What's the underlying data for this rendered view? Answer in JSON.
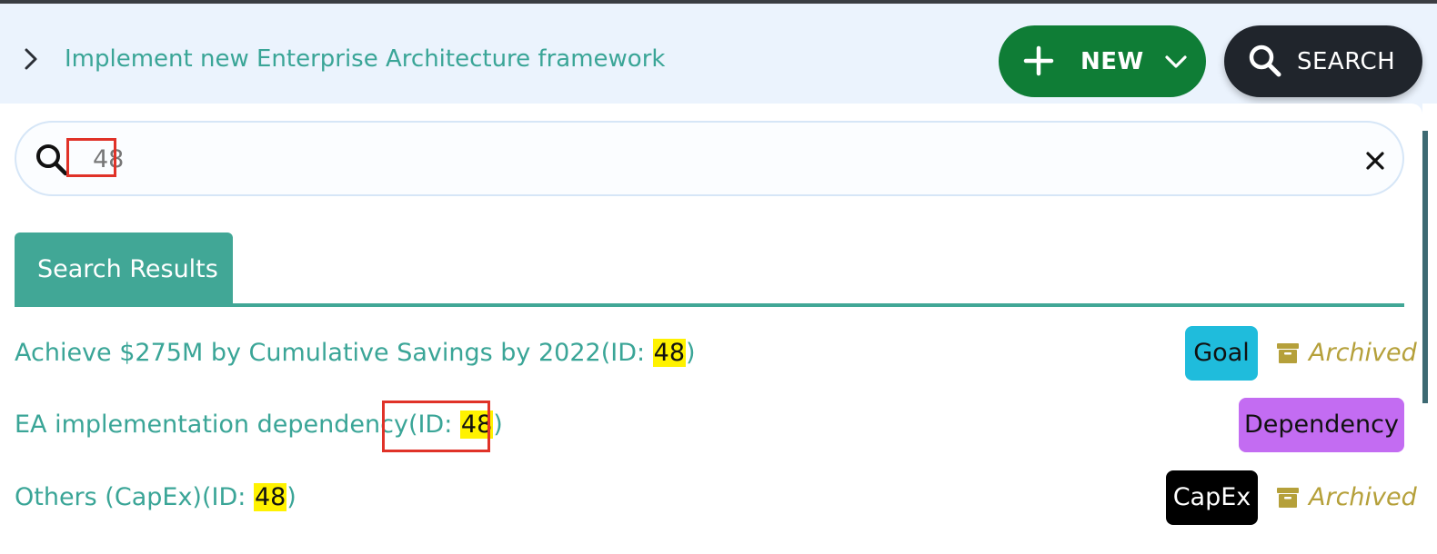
{
  "breadcrumb": {
    "current": "Implement new Enterprise Architecture framework"
  },
  "header": {
    "new_label": "NEW",
    "search_label": "SEARCH"
  },
  "search": {
    "value": "48"
  },
  "tabs": [
    {
      "label": "Search Results"
    }
  ],
  "results": [
    {
      "title": "Achieve $275M by Cumulative Savings by 2022",
      "id_prefix": "(ID: ",
      "id": "48",
      "id_suffix": ")",
      "type": "Goal",
      "status": "Archived"
    },
    {
      "title": "EA implementation dependency",
      "id_prefix": "(ID: ",
      "id": "48",
      "id_suffix": ")",
      "type": "Dependency",
      "status": ""
    },
    {
      "title": "Others (CapEx)",
      "id_prefix": "(ID: ",
      "id": "48",
      "id_suffix": ")",
      "type": "CapEx",
      "status": "Archived"
    }
  ],
  "colors": {
    "accent": "#3aa597",
    "new_button": "#0f7d36",
    "search_button": "#20252c",
    "goal_badge": "#1fbcdc",
    "dependency_badge": "#c36cf2",
    "capex_badge": "#000000",
    "archived": "#b5a03a",
    "highlight": "#fff200",
    "annotation_box": "#e03228"
  },
  "icons": {
    "breadcrumb_separator": "chevron-right-icon",
    "new": "plus-icon",
    "new_dropdown": "chevron-down-icon",
    "search": "search-icon",
    "clear": "close-icon",
    "archived": "archive-box-icon"
  }
}
